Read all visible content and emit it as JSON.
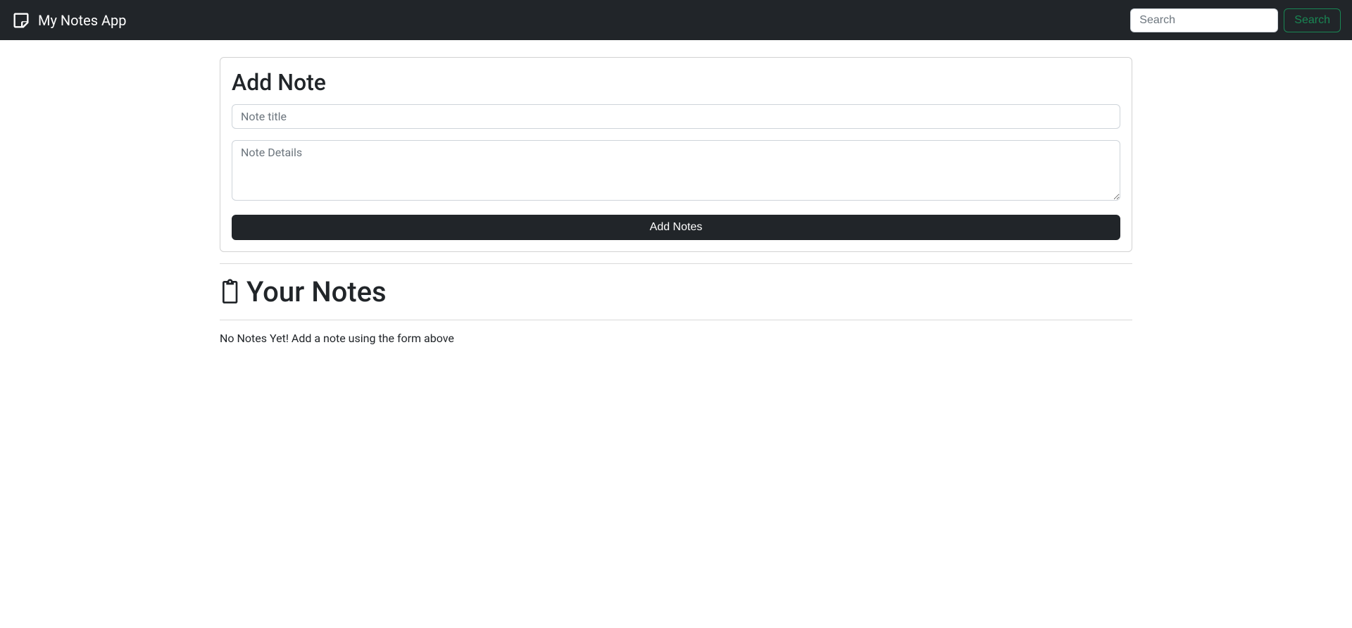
{
  "navbar": {
    "brand": "My Notes App",
    "search_placeholder": "Search",
    "search_button": "Search"
  },
  "add_note": {
    "heading": "Add Note",
    "title_placeholder": "Note title",
    "details_placeholder": "Note Details",
    "button_label": "Add Notes"
  },
  "notes_section": {
    "heading": "Your Notes",
    "empty_message": "No Notes Yet! Add a note using the form above"
  }
}
